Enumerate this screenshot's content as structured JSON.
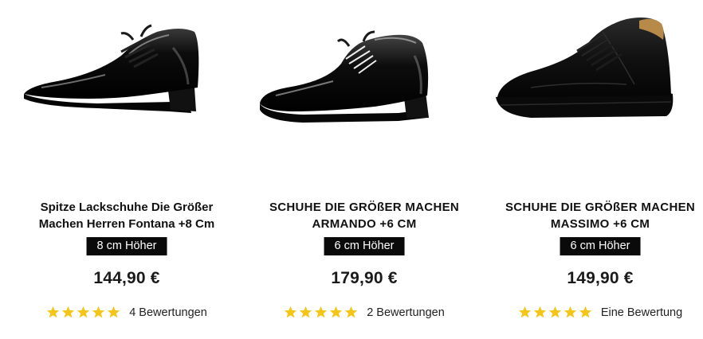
{
  "products": [
    {
      "title_line1": "Spitze Lackschuhe Die Größer",
      "title_line2": "Machen Herren Fontana +8 Cm",
      "badge": "8 cm Höher",
      "price": "144,90 €",
      "rating": 5,
      "reviews": "4 Bewertungen",
      "image": "patent-pointed-dress-shoe"
    },
    {
      "title_line1": "SCHUHE DIE GRÖßER MACHEN",
      "title_line2": "ARMANDO +6 CM",
      "badge": "6 cm Höher",
      "price": "179,90 €",
      "rating": 5,
      "reviews": "2 Bewertungen",
      "image": "patent-derby-shoe"
    },
    {
      "title_line1": "SCHUHE DIE GRÖßER MACHEN",
      "title_line2": "MASSIMO +6 CM",
      "badge": "6 cm Höher",
      "price": "149,90 €",
      "rating": 5,
      "reviews": "Eine Bewertung",
      "image": "leather-sneaker"
    }
  ],
  "colors": {
    "star": "#f5c518",
    "badge_bg": "#0a0a0a",
    "shoe": "#0b0b0b"
  }
}
